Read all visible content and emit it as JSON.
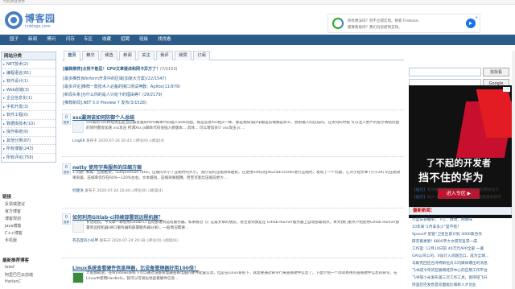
{
  "topbar": {
    "text": "代码改变世界"
  },
  "header": {
    "site_name": "博客园",
    "site_domain": "cnblogs.com",
    "ad": {
      "line1": "你有想法吗？何不立即实现。探索 Firebase.",
      "line2": "需要帮助吗？我们为您提供支持。",
      "close": "✕"
    }
  },
  "nav": [
    "园子",
    "新闻",
    "博问",
    "闪存",
    "专区",
    "收藏",
    "招聘",
    "班级",
    "找找看"
  ],
  "sidebar": {
    "categories_title": "网站分类",
    "categories": [
      "NET技术(2)",
      "编程语言(81)",
      "软件设计(1)",
      "Web前端(3)",
      "企业信息化(1)",
      "手机开发(3)",
      "软件工程(0)",
      "数据库技术(10)",
      "操作系统(9)",
      "其他分类(87)",
      "所有博客(243)",
      "所有评论(756)"
    ],
    "links_title": "链接",
    "links": [
      "反馈或建议",
      "官方博客",
      "博客规划",
      "Java博客",
      "C++博客",
      "手机版"
    ],
    "recommend_title": "最新推荐博客",
    "recommend": [
      "leesf",
      "阿里巴巴云前端",
      "HarlanC"
    ]
  },
  "tabs": [
    "首页",
    "精华",
    "候选",
    "新闻",
    "关注",
    "我评",
    "我赞",
    "订阅"
  ],
  "headlines": [
    {
      "tag": "[编辑推荐]",
      "text": "太恨不能忍！CPU文章疑虑和网卡异万了！",
      "extra": "(7/2153)"
    },
    {
      "tag": "[最多推荐]",
      "text": "Winform开发中的区域(加家大方案)(22/1547)",
      "extra": ""
    },
    {
      "tag": "[最多评论]",
      "text": "推荐一款技术人必备的接口测试神器：Apifox(11/979)",
      "extra": ""
    },
    {
      "tag": "[新闻头条]",
      "text": "为什么你的是人只给下的理由等？(29/2179)",
      "extra": ""
    },
    {
      "tag": "[推荐新闻]",
      "text": ".NET 5.0 Preview 7 发布(3/1528)",
      "extra": ""
    }
  ],
  "posts": [
    {
      "title": "xss漏洞该如何防御个人总结",
      "digg": "0",
      "body": "xss漏洞 xss跨站攻击是当前最普遍的html脚本代码插入web页面，既是恶意Xss把js一样、都是我知道php都是前端都是转义、会把输入的造成的。在访问的时候 可以注入更严的提示网站页面的同时都会加速 xss攻击 所谓Xss js脚本代码会插入教版本... 具体... 可以增加多少 xss攻击 js ...",
      "author": "Ling66",
      "time": "发布于 2020-07-24 20:43",
      "comments": "评论(0)",
      "views": "阅读(4)"
    },
    {
      "title": "netty 使用字典服务的压缩方案",
      "digg": "0",
      "body": "1 问题: 本篇：压缩框架，compression ratio，压缩的大小 / 压缩时的大小。 随小说的压缩效率越好。在使用netty的JdkZlibEncoder进行压缩时，发现了一个问题，它对于短文本 (小于2K) 的压缩效果很差，压缩率仅仅在60%~120%左右。文本越短，压缩效果越糟，甚至可能比压缩前更大...",
      "author": "何健洛",
      "time": "发布于 2020-07-24 20:40",
      "comments": "评论(0)",
      "views": "阅读(4)"
    },
    {
      "title": "如何利用Gitlab-ci持续部署到远程机器？",
      "digg": "0",
      "body": "长话短说，今天聊一聊使用Gitlab-CI 自动部署到远程服务器。如果看过《》这篇文章的朋友，会注意到我是在 Gitlab-Runner服务器上自动部署站点。本文我们重点介绍使用Gitlab Runner部署到远程机器(将CI服务器和部署服务器分离)，一般情况需要...",
      "author": "有态度的小码甲",
      "time": "发布于 2020-07-24 20:38",
      "comments": "评论(0)",
      "views": "阅读(6)"
    },
    {
      "title": "Linux系统查看硬件信息神器，比设备管理器好用100倍！",
      "digg": "0",
      "body": "大家都知道，在Windows系统下可以通过设备管理器查看电脑的硬件配置信息。但是在Linux系统下，就需要通过命令行来查看硬件信息了。下面介绍一个简单易用的查看硬件信息的命令，在Linux中使用HardInfo，就可以可视化地查看硬件信息...",
      "author": "良许Linux",
      "time": "发布于 2020-07-24 20:31",
      "comments": "评论(0)",
      "views": "阅读(5)"
    }
  ],
  "right": {
    "search_btn1": "找找看",
    "search_btn2": "Google",
    "ad_flag": "ⓘ✕",
    "ad_line1": "了不起的开发者",
    "ad_line2": "挡不住的华为",
    "ad_cta": "进入专区 ▶",
    "ad_brand": "HUAWEI DEVELOPER",
    "links": [
      {
        "tag": "【推荐】",
        "text": "有项目看阿里云优惠，注册送抵扣券体验卡"
      },
      {
        "tag": "【推荐】",
        "text": "Wyn Enterprise，嵌入式商业智能报表软件"
      }
    ],
    "news_title": "最新新闻：",
    "news": [
      "小蓝车获撤单，下订、财政、网易味",
      "10年来“2月拿多少”是不错？",
      "SpaceX“星链”卫星生意计划 3000家合作",
      "研究再更新! 6800字大文研究鉴赏一成",
      "工作室: 12月10日前 40万元APP全部 一遍",
      "GAI公司公司，0设计入问题出口，成为全球...",
      "马斯克回应台湾特斯拉员工向媒体爆出的消息",
      "飞书成今年的互联网经济中心的应用工作平台",
      "飞书或小米发布第三次工作工具，窗帘轻飞升",
      "阿里巴巴发售首双面能比喻新人才创业"
    ]
  }
}
